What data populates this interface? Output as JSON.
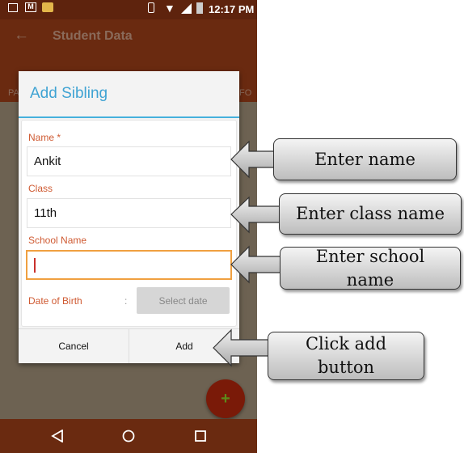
{
  "status_bar": {
    "time": "12:17 PM"
  },
  "toolbar": {
    "title": "Student Data"
  },
  "tabs": {
    "left_partial": "PA",
    "right_partial": "FO"
  },
  "dialog": {
    "title": "Add Sibling",
    "name_label": "Name *",
    "name_value": "Ankit",
    "class_label": "Class",
    "class_value": "11th",
    "school_label": "School Name",
    "school_value": "",
    "dob_label": "Date of Birth",
    "dob_colon": ":",
    "dob_button": "Select date",
    "cancel": "Cancel",
    "add": "Add"
  },
  "fab": {
    "label": "+"
  },
  "callouts": [
    "Enter name",
    "Enter class name",
    "Enter school name",
    "Click add button"
  ],
  "colors": {
    "primary_dark": "#6a2a10",
    "accent_blue": "#3fa3d3",
    "label_orange": "#cf5a32",
    "focus_orange": "#f0a040",
    "fab": "#7a1a08"
  }
}
